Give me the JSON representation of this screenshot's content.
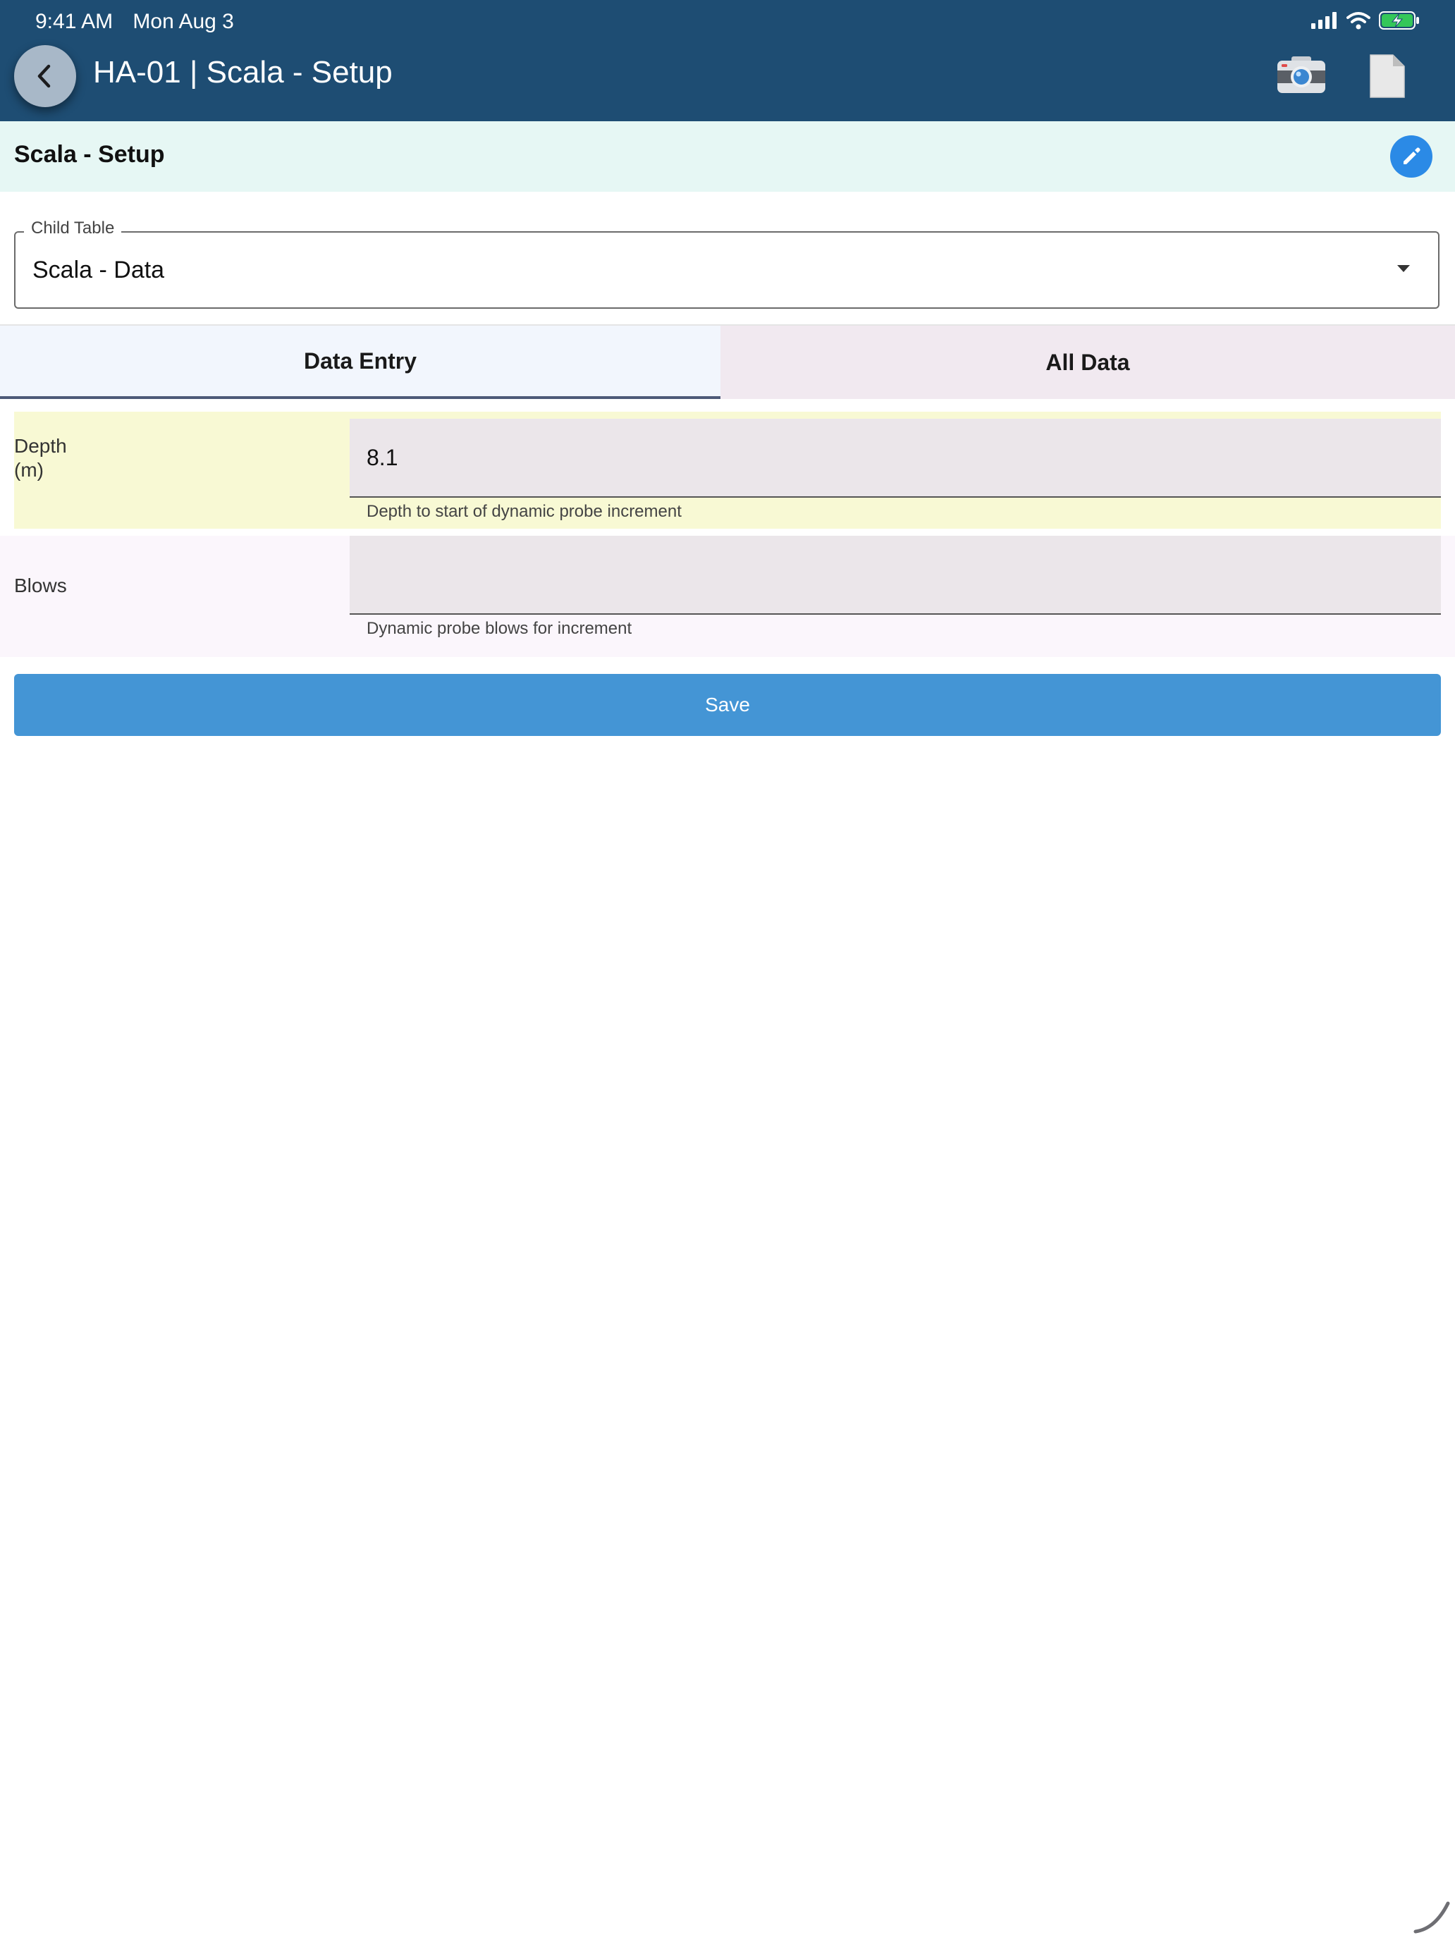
{
  "status_bar": {
    "time": "9:41 AM",
    "date": "Mon Aug 3",
    "icons": [
      "cellular-signal-icon",
      "wifi-icon",
      "battery-charging-icon"
    ]
  },
  "header": {
    "title": "HA-01 | Scala - Setup",
    "back_icon": "chevron-left-icon",
    "camera_icon": "camera-icon",
    "document_icon": "document-icon"
  },
  "section": {
    "title": "Scala - Setup",
    "edit_icon": "pencil-icon"
  },
  "child_table": {
    "label": "Child Table",
    "value": "Scala - Data"
  },
  "tabs": [
    {
      "label": "Data Entry",
      "active": true
    },
    {
      "label": "All Data",
      "active": false
    }
  ],
  "form": {
    "depth": {
      "label_line1": "Depth",
      "label_line2": "(m)",
      "value": "8.1",
      "help": "Depth to start of dynamic probe increment"
    },
    "blows": {
      "label": "Blows",
      "value": "",
      "help": "Dynamic probe blows for increment"
    }
  },
  "save_label": "Save",
  "colors": {
    "header_bg": "#1e4d73",
    "section_bg": "#e6f7f4",
    "accent": "#4495d5",
    "highlight_row": "#f8f9d4"
  }
}
